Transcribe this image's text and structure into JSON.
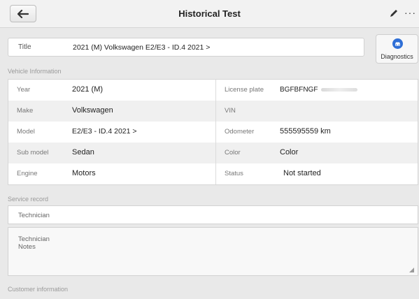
{
  "header": {
    "title": "Historical Test",
    "back_icon": "arrow-left-icon",
    "edit_icon": "pen-icon",
    "more_label": "···"
  },
  "title_field": {
    "label": "Title",
    "value": "2021 (M) Volkswagen E2/E3 - ID.4 2021 >"
  },
  "diagnostics": {
    "label": "Diagnostics",
    "icon": "car-icon",
    "color": "#2f6fd6"
  },
  "vehicle_info": {
    "section_label": "Vehicle Information",
    "rows": [
      {
        "left_label": "Year",
        "left_value": "2021 (M)",
        "right_label": "License plate",
        "right_value": "BGFBFNGF"
      },
      {
        "left_label": "Make",
        "left_value": "Volkswagen",
        "right_label": "VIN",
        "right_value": ""
      },
      {
        "left_label": "Model",
        "left_value": "E2/E3 - ID.4 2021 >",
        "right_label": "Odometer",
        "right_value": "555595559 km"
      },
      {
        "left_label": "Sub model",
        "left_value": "Sedan",
        "right_label": "Color",
        "right_value": "Color"
      },
      {
        "left_label": "Engine",
        "left_value": "Motors",
        "right_label": "Status",
        "right_value": "Not started"
      }
    ]
  },
  "service_record": {
    "section_label": "Service record",
    "technician_label": "Technician",
    "notes_label": "Technician Notes"
  },
  "customer_info": {
    "section_label": "Customer information"
  }
}
